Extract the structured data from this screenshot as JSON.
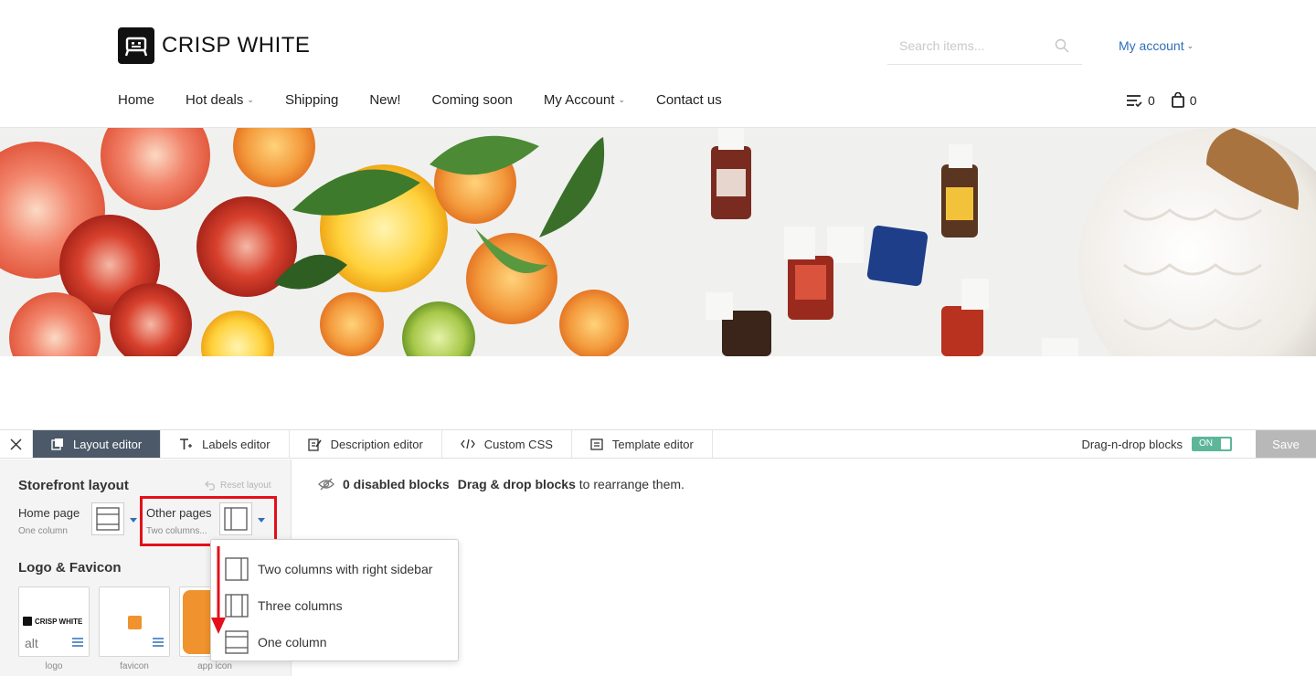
{
  "header": {
    "logo_text": "CRISP WHITE",
    "search_placeholder": "Search items...",
    "my_account": "My account",
    "nav": [
      {
        "label": "Home",
        "has_dropdown": false
      },
      {
        "label": "Hot deals",
        "has_dropdown": true
      },
      {
        "label": "Shipping",
        "has_dropdown": false
      },
      {
        "label": "New!",
        "has_dropdown": false
      },
      {
        "label": "Coming soon",
        "has_dropdown": false
      },
      {
        "label": "My Account",
        "has_dropdown": true
      },
      {
        "label": "Contact us",
        "has_dropdown": false
      }
    ],
    "compare_count": "0",
    "cart_count": "0"
  },
  "editor": {
    "tabs": [
      {
        "label": "Layout editor",
        "icon": "layout-icon",
        "active": true
      },
      {
        "label": "Labels editor",
        "icon": "text-icon",
        "active": false
      },
      {
        "label": "Description editor",
        "icon": "edit-icon",
        "active": false
      },
      {
        "label": "Custom CSS",
        "icon": "code-icon",
        "active": false
      },
      {
        "label": "Template editor",
        "icon": "template-icon",
        "active": false
      }
    ],
    "dnd_label": "Drag-n-drop blocks",
    "dnd_toggle": "ON",
    "save_label": "Save",
    "sidebar": {
      "storefront_title": "Storefront layout",
      "reset_label": "Reset layout",
      "home_label": "Home page",
      "home_value": "One column",
      "other_label": "Other pages",
      "other_value": "Two columns...",
      "logo_title": "Logo & Favicon",
      "logo_card_text": "CRISP WHITE",
      "alt_label": "alt",
      "cards": [
        "logo",
        "favicon",
        "app icon"
      ]
    },
    "info": {
      "disabled_count": "0 disabled blocks",
      "dnd_bold": "Drag & drop blocks",
      "dnd_rest": "to rearrange them."
    },
    "layout_options": [
      "Two columns with right sidebar",
      "Three columns",
      "One column"
    ]
  },
  "colors": {
    "accent_blue": "#2f6fb7",
    "active_tab": "#4b5968",
    "toggle_green": "#5eb69a",
    "highlight_red": "#e3101a",
    "favicon_orange": "#f0922e"
  }
}
